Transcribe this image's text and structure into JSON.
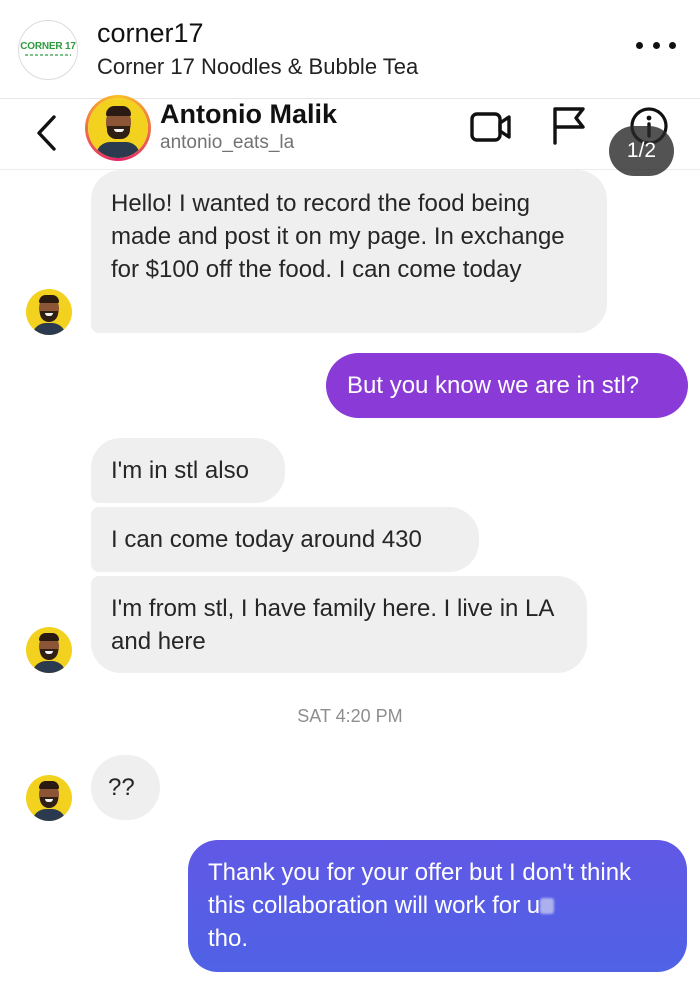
{
  "account": {
    "username": "corner17",
    "full_name": "Corner 17 Noodles & Bubble Tea",
    "logo_text": "CORNER 17",
    "logo_color": "#2f9a3f"
  },
  "thread": {
    "contact_name": "Antonio Malik",
    "contact_handle": "antonio_eats_la",
    "page_counter": "1/2",
    "icons": [
      "back-arrow-icon",
      "video-camera-icon",
      "flag-icon",
      "info-icon",
      "more-options-icon"
    ]
  },
  "messages": [
    {
      "from": "them",
      "text": "Hello! I wanted to record the food being made and post it on my page. In exchange for $100 off the food. I can come today"
    },
    {
      "from": "me",
      "text": "But you know we are in stl?"
    },
    {
      "from": "them",
      "text": "I'm in stl also"
    },
    {
      "from": "them",
      "text": "I can come today around 430"
    },
    {
      "from": "them",
      "text": "I'm from stl, I have family here. I live in LA and here"
    },
    {
      "from": "them",
      "text": "??"
    },
    {
      "from": "me",
      "text": "Thank you for your offer but I don't think this collaboration will work for u"
    },
    {
      "from": "me",
      "text": "tho."
    }
  ],
  "timestamp": "SAT 4:20 PM",
  "colors": {
    "incoming_bubble": "#efefef",
    "outgoing_purple": "#8a3ad6",
    "outgoing_blue": "#5a5de8",
    "avatar_background": "#f2d21f"
  }
}
